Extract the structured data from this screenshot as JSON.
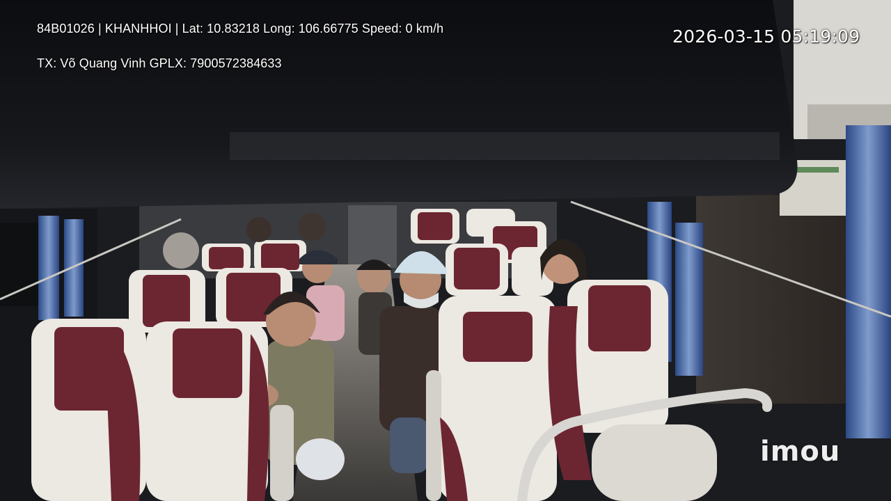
{
  "camera_overlay": {
    "vehicle_line": "84B01026 | KHANHHOI | Lat: 10.83218 Long: 106.66775 Speed: 0 km/h",
    "driver_line": "TX: Võ Quang Vinh GPLX: 7900572384633",
    "timestamp": "2026-03-15 05:19:09",
    "watermark": "imou"
  },
  "scene": {
    "setting": "bus interior",
    "seat_colors": {
      "cream": "#ece8e2",
      "maroon": "#6c2631"
    }
  }
}
